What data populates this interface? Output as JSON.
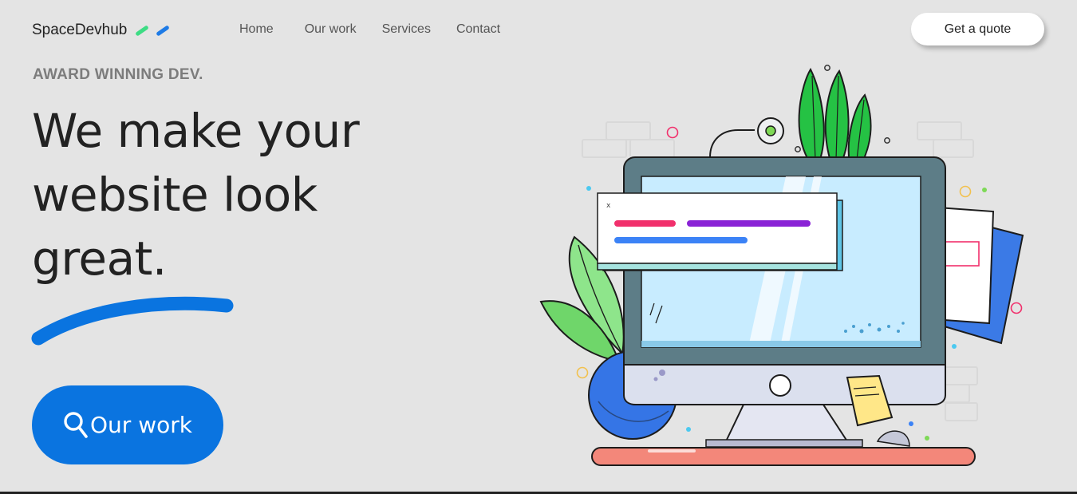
{
  "brand": {
    "name": "SpaceDevhub",
    "mark_colors": [
      "#3ddc84",
      "#1e7be6"
    ]
  },
  "nav": {
    "items": [
      {
        "label": "Home"
      },
      {
        "label": "Our work"
      },
      {
        "label": "Services"
      },
      {
        "label": "Contact"
      }
    ],
    "cta_label": "Get a quote"
  },
  "hero": {
    "eyebrow": "AWARD WINNING DEV.",
    "headline_lines": [
      "We make your",
      "website look",
      "great."
    ],
    "cta_label": "Our work",
    "cta_icon": "search-icon",
    "swoosh_color": "#0a74e0"
  },
  "illustration": {
    "popup_close": "x",
    "bar_colors": [
      "#f1306c",
      "#8a23d6",
      "#3b82f6"
    ],
    "accent": "#0a74e0"
  }
}
